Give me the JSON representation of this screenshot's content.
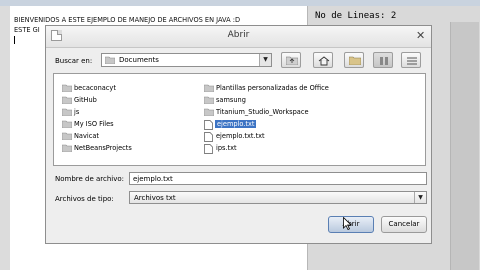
{
  "editor": {
    "line1": "BIENVENIDOS A ESTE EJEMPLO DE MANEJO DE ARCHIVOS EN JAVA :D",
    "line2": "ESTE GI",
    "lines_label": "No de Lineas: 2"
  },
  "dialog": {
    "title": "Abrir",
    "look_in_label": "Buscar en:",
    "look_in_value": "Documents",
    "toolbar_icons": [
      "folder-up-icon",
      "home-icon",
      "new-folder-icon",
      "list-view-icon",
      "details-view-icon"
    ],
    "files": [
      {
        "name": "becaconacyt",
        "icon": "folder-icon"
      },
      {
        "name": "GitHub",
        "icon": "folder-icon"
      },
      {
        "name": "js",
        "icon": "folder-icon"
      },
      {
        "name": "My ISO Files",
        "icon": "folder-icon"
      },
      {
        "name": "Navicat",
        "icon": "folder-icon"
      },
      {
        "name": "NetBeansProjects",
        "icon": "folder-icon"
      },
      {
        "name": "Plantillas personalizadas de Office",
        "icon": "folder-icon"
      },
      {
        "name": "samsung",
        "icon": "folder-icon"
      },
      {
        "name": "Titanium_Studio_Workspace",
        "icon": "folder-icon"
      },
      {
        "name": "ejemplo.txt",
        "icon": "file-icon",
        "selected": true
      },
      {
        "name": "ejemplo.txt.txt",
        "icon": "file-icon"
      },
      {
        "name": "ips.txt",
        "icon": "file-icon"
      }
    ],
    "filename_label": "Nombre de archivo:",
    "filename_value": "ejemplo.txt",
    "filetype_label": "Archivos de tipo:",
    "filetype_value": "Archivos txt",
    "open_label": "Abrir",
    "cancel_label": "Cancelar"
  },
  "colors": {
    "selection": "#3d74c4",
    "folder": "#c7c7c7",
    "primary_button_border": "#5a7fb3"
  }
}
